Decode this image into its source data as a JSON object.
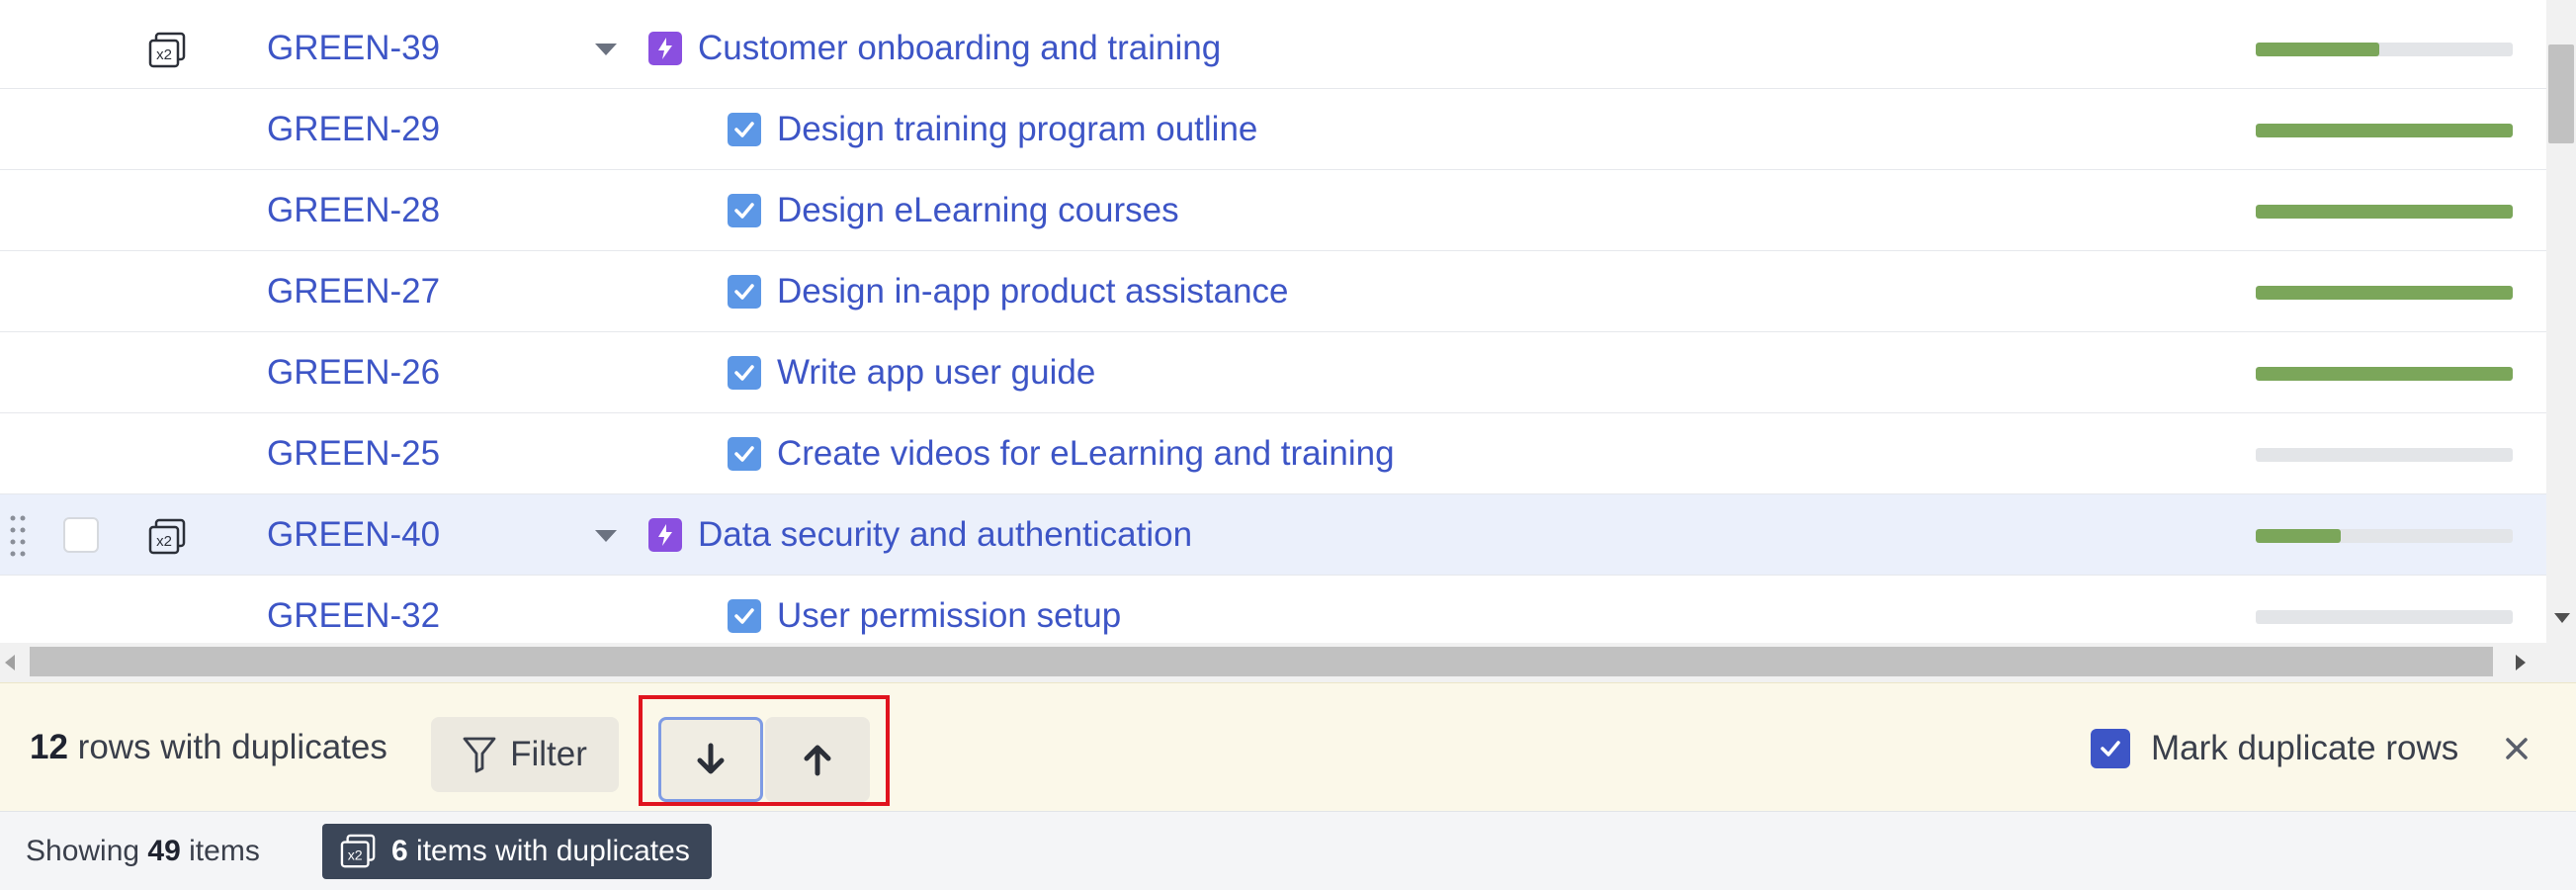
{
  "rows": [
    {
      "key": "GREEN-39",
      "title": "Customer onboarding and training",
      "type": "epic",
      "progress": 0.48,
      "duplicate": true,
      "selected": false
    },
    {
      "key": "GREEN-29",
      "title": "Design training program outline",
      "type": "task",
      "progress": 1.0
    },
    {
      "key": "GREEN-28",
      "title": "Design eLearning courses",
      "type": "task",
      "progress": 1.0
    },
    {
      "key": "GREEN-27",
      "title": "Design in-app product assistance",
      "type": "task",
      "progress": 1.0
    },
    {
      "key": "GREEN-26",
      "title": "Write app user guide",
      "type": "task",
      "progress": 1.0
    },
    {
      "key": "GREEN-25",
      "title": "Create videos for eLearning and training",
      "type": "task",
      "progress": 0
    },
    {
      "key": "GREEN-40",
      "title": "Data security and authentication",
      "type": "epic",
      "progress": 0.33,
      "duplicate": true,
      "selected": true
    },
    {
      "key": "GREEN-32",
      "title": "User permission setup",
      "type": "task",
      "progress": 0
    }
  ],
  "dup_toolbar": {
    "count": "12",
    "count_suffix": "rows with duplicates",
    "filter_label": "Filter",
    "mark_label": "Mark duplicate rows",
    "mark_checked": true
  },
  "status_bar": {
    "showing_prefix": "Showing",
    "showing_count": "49",
    "showing_suffix": "items",
    "dup_items_count": "6",
    "dup_items_suffix": "items with duplicates"
  },
  "dup_badge_text": "x2",
  "icons": {
    "duplicate": "duplicate-x2-icon",
    "epic": "lightning-icon",
    "task": "checkbox-task-icon",
    "filter": "funnel-icon",
    "down": "arrow-down-icon",
    "up": "arrow-up-icon",
    "close": "close-icon",
    "drag": "drag-handle-icon"
  },
  "colors": {
    "link": "#3d55c6",
    "epic": "#8a4fe0",
    "task": "#5c97e6",
    "progress": "#7ba65a",
    "highlight": "#e0141e",
    "toolbar_bg": "#fbf8e9"
  }
}
